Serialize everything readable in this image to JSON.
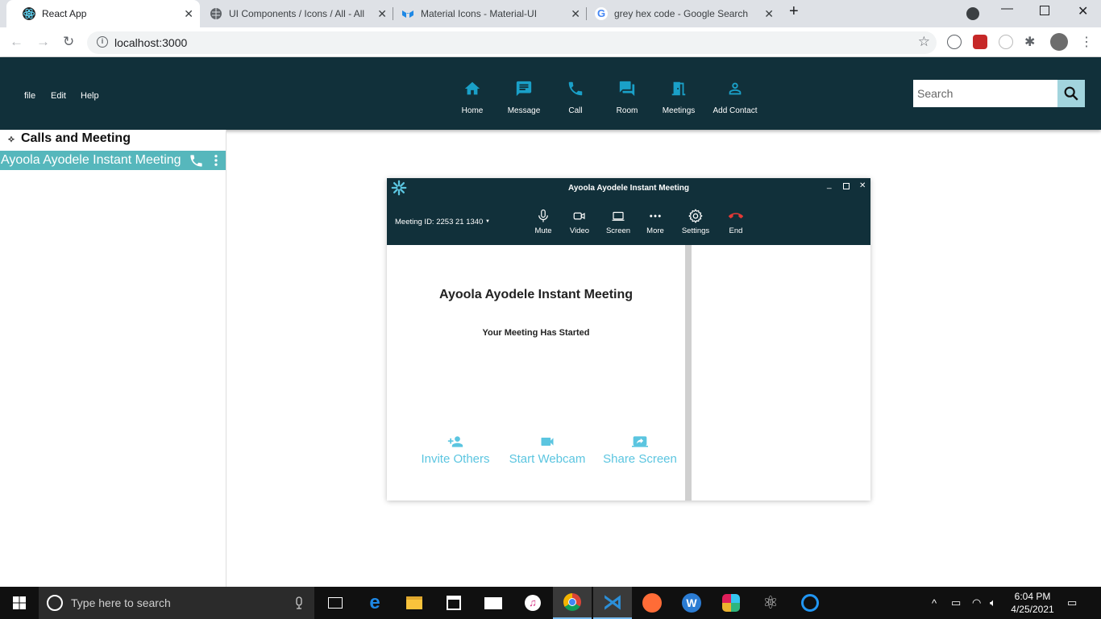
{
  "browser": {
    "tabs": [
      {
        "title": "React App",
        "icon": "react-icon"
      },
      {
        "title": "UI Components / Icons / All - All",
        "icon": "globe-icon"
      },
      {
        "title": "Material Icons - Material-UI",
        "icon": "material-ui-icon"
      },
      {
        "title": "grey hex code - Google Search",
        "icon": "google-icon"
      }
    ],
    "url": "localhost:3000"
  },
  "appbar": {
    "menus": [
      "file",
      "Edit",
      "Help"
    ],
    "nav": [
      "Home",
      "Message",
      "Call",
      "Room",
      "Meetings",
      "Add Contact"
    ],
    "search_placeholder": "Search"
  },
  "sidebar": {
    "heading": "Calls and Meeting",
    "item": "Ayoola Ayodele Instant Meeting"
  },
  "meeting": {
    "window_title": "Ayoola Ayodele Instant Meeting",
    "meeting_id": "Meeting ID: 2253 21 1340",
    "controls": [
      "Mute",
      "Video",
      "Screen",
      "More",
      "Settings",
      "End"
    ],
    "title": "Ayoola Ayodele Instant Meeting",
    "status": "Your Meeting Has Started",
    "actions": [
      "Invite Others",
      "Start Webcam",
      "Share Screen"
    ]
  },
  "taskbar": {
    "search_placeholder": "Type here to search",
    "time": "6:04 PM",
    "date": "4/25/2021"
  },
  "colors": {
    "appbar": "#11303a",
    "accent": "#56b7bc",
    "action": "#5bc5e0",
    "end_call": "#e53935"
  }
}
